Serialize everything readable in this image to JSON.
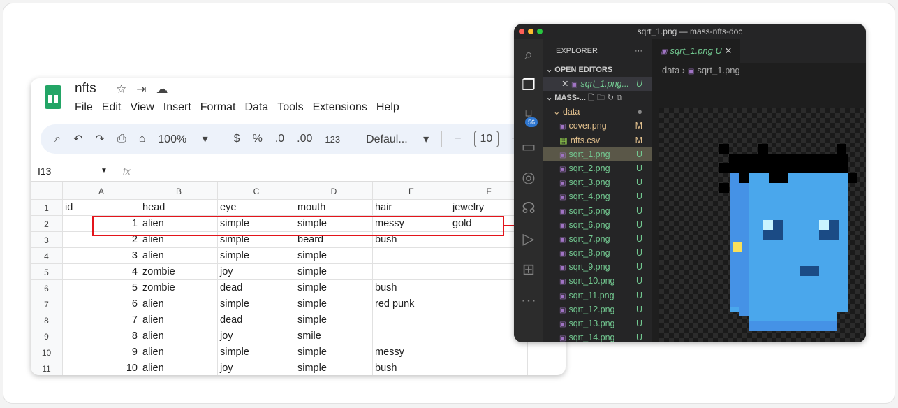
{
  "sheets": {
    "title": "nfts",
    "menu": [
      "File",
      "Edit",
      "View",
      "Insert",
      "Format",
      "Data",
      "Tools",
      "Extensions",
      "Help"
    ],
    "toolbar": {
      "zoom": "100%",
      "currency": "$",
      "percent": "%",
      "dec_dec": ".0",
      "inc_dec": ".00",
      "format_123": "123",
      "font": "Defaul...",
      "font_size": "10"
    },
    "name_box": "I13",
    "fx": "fx",
    "columns": [
      "A",
      "B",
      "C",
      "D",
      "E",
      "F",
      ""
    ],
    "rows": [
      [
        "1",
        "id",
        "head",
        "eye",
        "mouth",
        "hair",
        "jewelry",
        ""
      ],
      [
        "2",
        "1",
        "alien",
        "simple",
        "simple",
        "messy",
        "gold",
        ""
      ],
      [
        "3",
        "2",
        "alien",
        "simple",
        "beard",
        "bush",
        "",
        ""
      ],
      [
        "4",
        "3",
        "alien",
        "simple",
        "simple",
        "",
        "",
        ""
      ],
      [
        "5",
        "4",
        "zombie",
        "joy",
        "simple",
        "",
        "",
        ""
      ],
      [
        "6",
        "5",
        "zombie",
        "dead",
        "simple",
        "bush",
        "",
        ""
      ],
      [
        "7",
        "6",
        "alien",
        "simple",
        "simple",
        "red punk",
        "",
        ""
      ],
      [
        "8",
        "7",
        "alien",
        "dead",
        "simple",
        "",
        "",
        ""
      ],
      [
        "9",
        "8",
        "alien",
        "joy",
        "smile",
        "",
        "",
        ""
      ],
      [
        "10",
        "9",
        "alien",
        "simple",
        "simple",
        "messy",
        "",
        ""
      ],
      [
        "11",
        "10",
        "alien",
        "joy",
        "simple",
        "bush",
        "",
        ""
      ]
    ]
  },
  "vscode": {
    "window_title": "sqrt_1.png — mass-nfts-doc",
    "scm_badge": "56",
    "explorer_label": "EXPLORER",
    "open_editors_label": "OPEN EDITORS",
    "open_editor": {
      "name": "sqrt_1.png...",
      "status": "U"
    },
    "project_label": "MASS-...",
    "folder": "data",
    "files": [
      {
        "name": "cover.png",
        "status": "M",
        "icon": "image-icon"
      },
      {
        "name": "nfts.csv",
        "status": "M",
        "icon": "table-icon"
      },
      {
        "name": "sqrt_1.png",
        "status": "U",
        "icon": "image-icon"
      },
      {
        "name": "sqrt_2.png",
        "status": "U",
        "icon": "image-icon"
      },
      {
        "name": "sqrt_3.png",
        "status": "U",
        "icon": "image-icon"
      },
      {
        "name": "sqrt_4.png",
        "status": "U",
        "icon": "image-icon"
      },
      {
        "name": "sqrt_5.png",
        "status": "U",
        "icon": "image-icon"
      },
      {
        "name": "sqrt_6.png",
        "status": "U",
        "icon": "image-icon"
      },
      {
        "name": "sqrt_7.png",
        "status": "U",
        "icon": "image-icon"
      },
      {
        "name": "sqrt_8.png",
        "status": "U",
        "icon": "image-icon"
      },
      {
        "name": "sqrt_9.png",
        "status": "U",
        "icon": "image-icon"
      },
      {
        "name": "sqrt_10.png",
        "status": "U",
        "icon": "image-icon"
      },
      {
        "name": "sqrt_11.png",
        "status": "U",
        "icon": "image-icon"
      },
      {
        "name": "sqrt_12.png",
        "status": "U",
        "icon": "image-icon"
      },
      {
        "name": "sqrt_13.png",
        "status": "U",
        "icon": "image-icon"
      },
      {
        "name": "sqrt_14.png",
        "status": "U",
        "icon": "image-icon"
      }
    ],
    "tab": {
      "name": "sqrt_1.png",
      "status": "U"
    },
    "breadcrumb": [
      "data",
      "sqrt_1.png"
    ],
    "colors": {
      "face": "#4aa7ec",
      "face_shade": "#4592e6",
      "eye": "#1b4b85",
      "eye_highlight": "#c8f4ff",
      "earring": "#f9e05a",
      "hair": "#000000",
      "highlight": "#e3141b"
    }
  }
}
